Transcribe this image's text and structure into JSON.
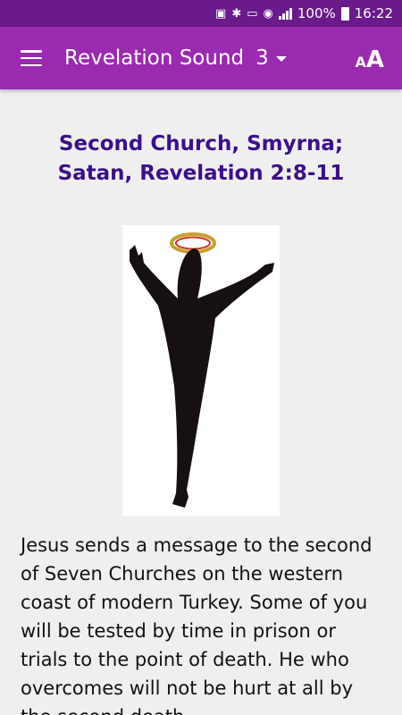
{
  "status_bar": {
    "battery": "100%",
    "time": "16:22"
  },
  "app_bar": {
    "title": "Revelation Sound",
    "chapter": "3"
  },
  "content": {
    "heading": "Second Church, Smyrna; Satan, Revelation 2:8-11",
    "body": "Jesus sends a message to the second of Seven Churches on the western coast of modern Turkey. Some of you will be tested by time in prison or trials to the point of death. He who overcomes will not be hurt at all by the second death"
  },
  "colors": {
    "status_bar": "#6a1a8a",
    "app_bar": "#9a2bb0",
    "heading": "#3b0f8a",
    "background": "#efefef"
  }
}
